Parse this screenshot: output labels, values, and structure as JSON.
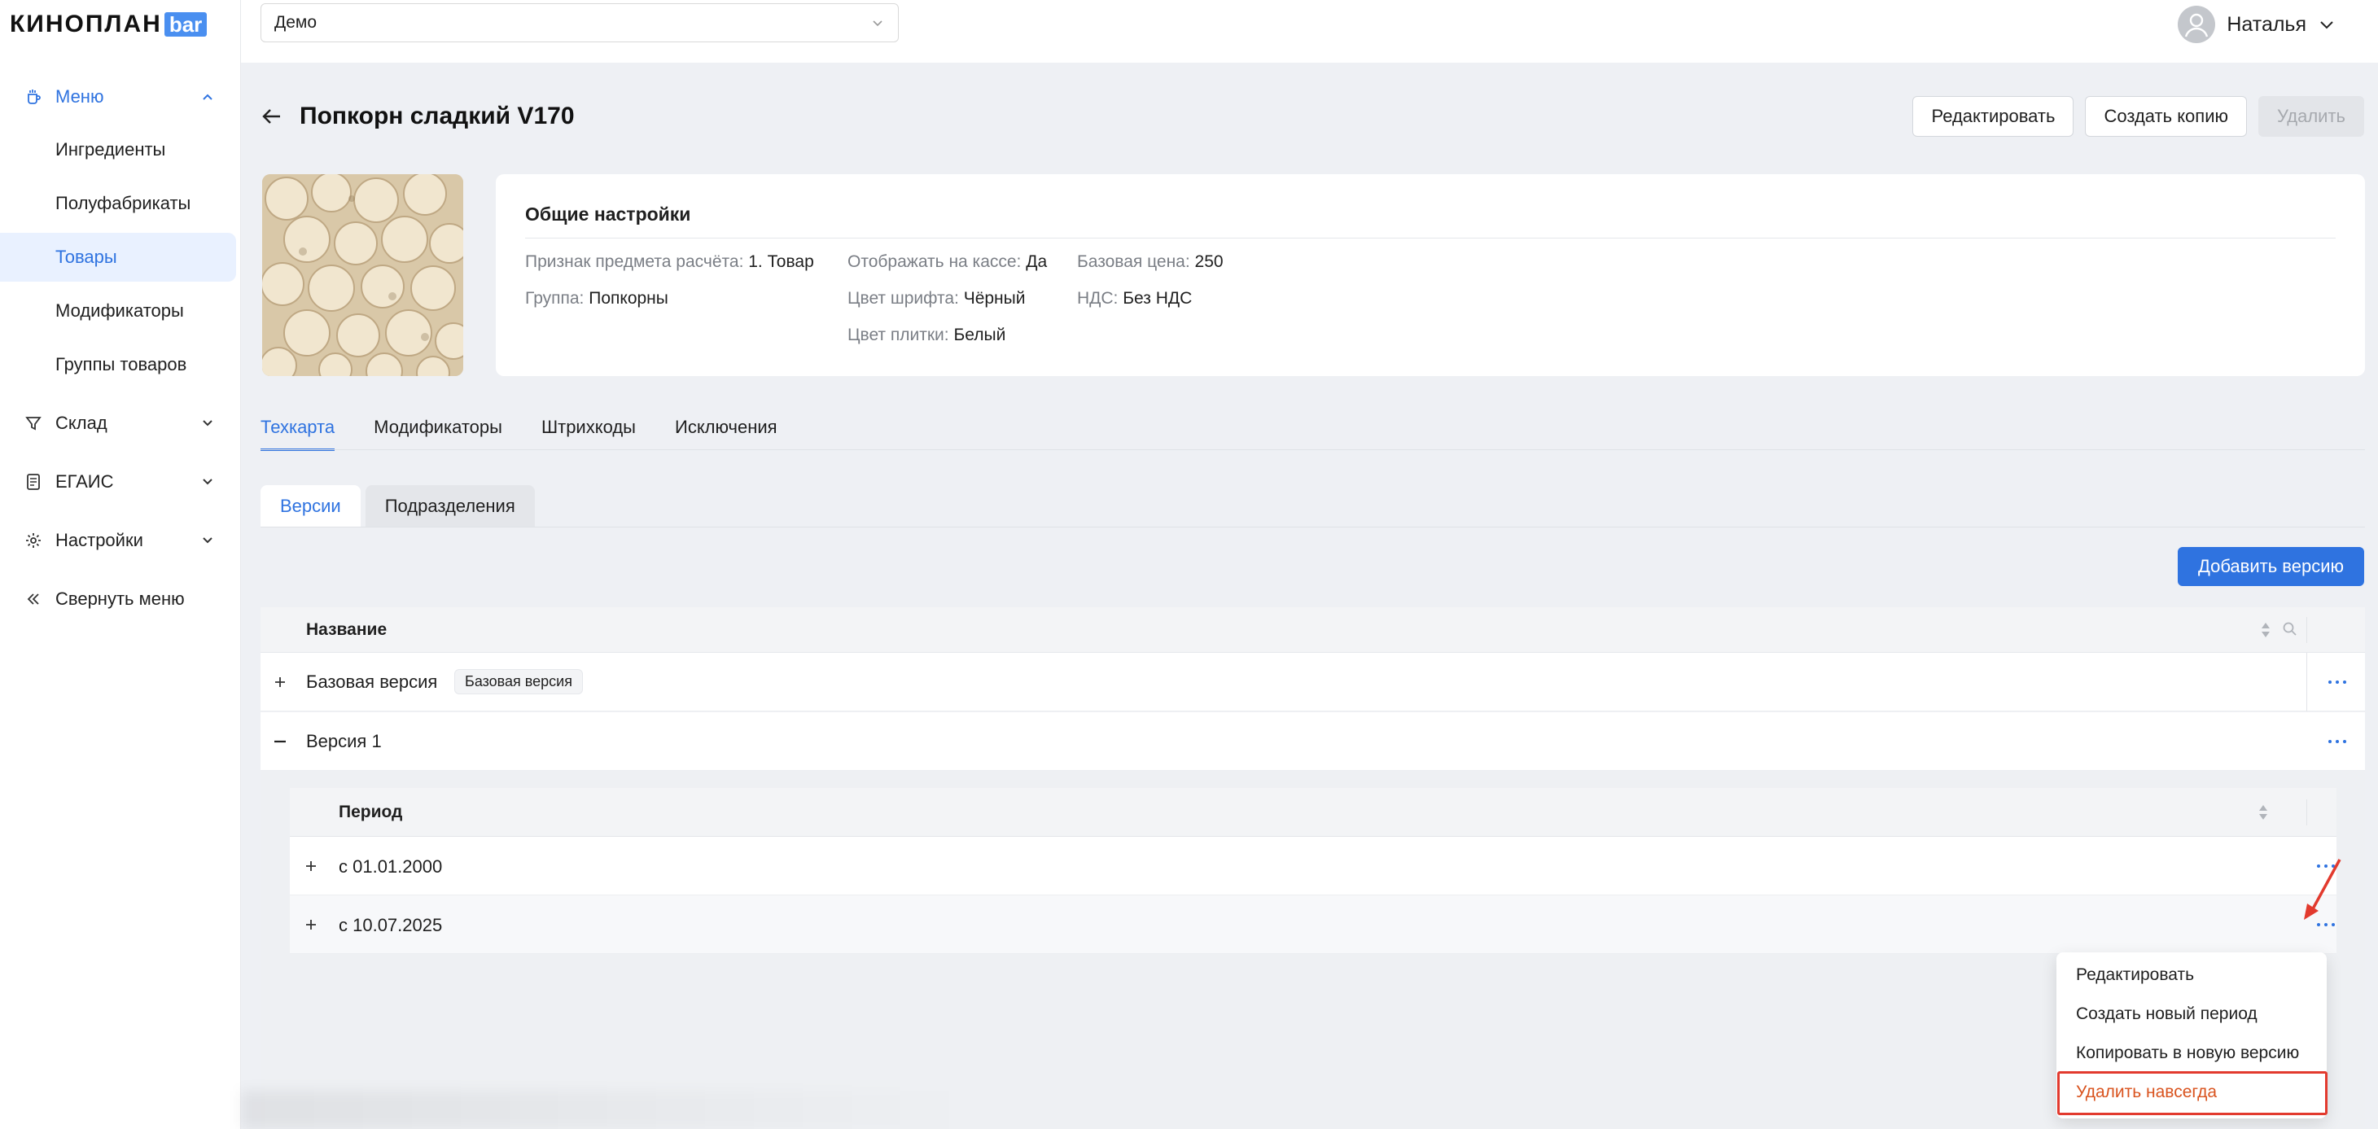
{
  "app": {
    "logo_main": "КИНОПЛАН",
    "logo_badge": "bar"
  },
  "topbar": {
    "tenant": "Демо",
    "user_name": "Наталья"
  },
  "sidebar": {
    "menu": {
      "label": "Меню"
    },
    "items": [
      {
        "label": "Ингредиенты"
      },
      {
        "label": "Полуфабрикаты"
      },
      {
        "label": "Товары"
      },
      {
        "label": "Модификаторы"
      },
      {
        "label": "Группы товаров"
      }
    ],
    "sklad": {
      "label": "Склад"
    },
    "egais": {
      "label": "ЕГАИС"
    },
    "settings": {
      "label": "Настройки"
    },
    "collapse": {
      "label": "Свернуть меню"
    }
  },
  "page": {
    "title": "Попкорн сладкий V170",
    "actions": {
      "edit": "Редактировать",
      "copy": "Создать копию",
      "delete": "Удалить"
    }
  },
  "general": {
    "title": "Общие настройки",
    "fields": [
      {
        "key": "Признак предмета расчёта:",
        "value": "1. Товар"
      },
      {
        "key": "Группа:",
        "value": "Попкорны"
      },
      {
        "key": "Отображать на кассе:",
        "value": "Да"
      },
      {
        "key": "Цвет шрифта:",
        "value": "Чёрный"
      },
      {
        "key": "Цвет плитки:",
        "value": "Белый"
      },
      {
        "key": "Базовая цена:",
        "value": "250"
      },
      {
        "key": "НДС:",
        "value": "Без НДС"
      }
    ]
  },
  "tabs": [
    "Техкарта",
    "Модификаторы",
    "Штрихкоды",
    "Исключения"
  ],
  "subtabs": [
    "Версии",
    "Подразделения"
  ],
  "versions": {
    "add_button": "Добавить версию",
    "column": "Название",
    "rows": [
      {
        "name": "Базовая версия",
        "tag": "Базовая версия"
      },
      {
        "name": "Версия 1"
      }
    ],
    "nested": {
      "column": "Период",
      "rows": [
        {
          "label": "с 01.01.2000"
        },
        {
          "label": "с 10.07.2025"
        }
      ]
    }
  },
  "context_menu": {
    "items": [
      "Редактировать",
      "Создать новый период",
      "Копировать в новую версию",
      "Удалить навсегда"
    ]
  },
  "colors": {
    "accent": "#2f73e0",
    "danger": "#d9531e",
    "highlight": "#e23a2e"
  }
}
